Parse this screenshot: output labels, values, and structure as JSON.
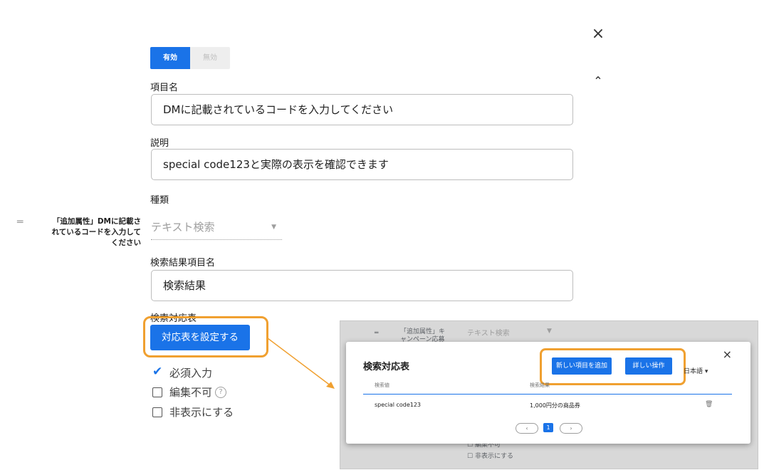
{
  "close_icon": "×",
  "collapse_icon": "⌃",
  "toggle": {
    "active_label": "有効",
    "inactive_label": "無効"
  },
  "item_name": {
    "label": "項目名",
    "value": "DMに記載されているコードを入力してください"
  },
  "description": {
    "label": "説明",
    "value": "special code123と実際の表示を確認できます"
  },
  "kind": {
    "label": "種類",
    "value": "テキスト検索"
  },
  "sidebar": {
    "handle": "═",
    "item_label": "「追加属性」DMに記載されているコードを入力してください"
  },
  "result_item_name": {
    "label": "検索結果項目名",
    "value": "検索結果"
  },
  "table_section": {
    "label": "検索対応表",
    "button": "対応表を設定する"
  },
  "checkboxes": {
    "required": "必須入力",
    "not_editable": "編集不可",
    "hidden": "非表示にする",
    "help_icon": "?"
  },
  "inset": {
    "bg_label": "「追加属性」キャンペーン応募",
    "bg_select": "テキスト検索",
    "bg_not_editable": "編集不可",
    "bg_hidden": "非表示にする",
    "modal": {
      "title": "検索対応表",
      "add_button": "新しい項目を追加",
      "detail_button": "詳しい操作",
      "language": "日本語 ▾",
      "columns": [
        "検索値",
        "検索結果"
      ],
      "rows": [
        {
          "key": "special code123",
          "result": "1,000円分の商品券"
        }
      ],
      "pagination": {
        "prev": "‹",
        "current": "1",
        "next": "›"
      },
      "trash_icon": "🗑"
    }
  },
  "colors": {
    "primary": "#1a73e8",
    "highlight": "#f0a030"
  }
}
